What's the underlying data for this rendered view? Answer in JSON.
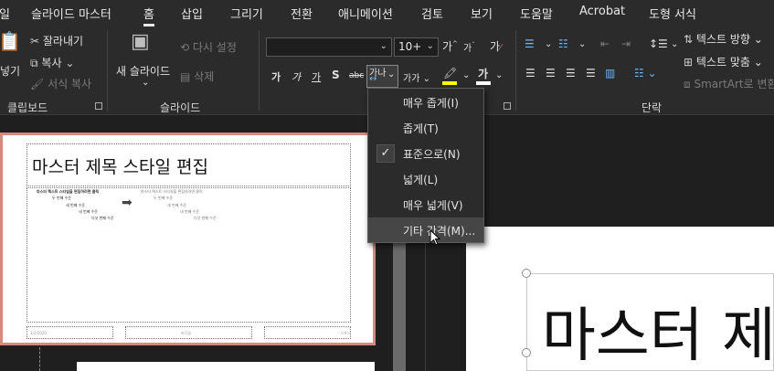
{
  "tabs": [
    {
      "label": "일",
      "x": 0
    },
    {
      "label": "슬라이드 마스터"
    },
    {
      "label": "홈"
    },
    {
      "label": "삽입"
    },
    {
      "label": "그리기"
    },
    {
      "label": "전환"
    },
    {
      "label": "애니메이션"
    },
    {
      "label": "검토"
    },
    {
      "label": "보기"
    },
    {
      "label": "도움말"
    },
    {
      "label": "Acrobat"
    },
    {
      "label": "도형 서식"
    }
  ],
  "clipboard": {
    "paste": "넣기",
    "cut": "잘라내기",
    "copy": "복사",
    "format_painter": "서식 복사",
    "group": "클립보드"
  },
  "slides": {
    "new_slide": "새 슬라이드",
    "reuse": "다시 설정",
    "delete": "삭제",
    "group": "슬라이드"
  },
  "font": {
    "font_name": "",
    "font_size": "10+",
    "grow": "가",
    "shrink": "가",
    "clear": "가",
    "bold": "가",
    "italic": "가",
    "underline": "가",
    "shadow": "S",
    "strike": "abc",
    "spacing": "가나",
    "case": "가가",
    "color_a": "가"
  },
  "paragraph": {
    "text_direction": "텍스트 방향",
    "align_text": "텍스트 맞춤",
    "smartart": "SmartArt로 변환",
    "group": "단락"
  },
  "spacing_menu": {
    "items": [
      {
        "label": "매우 좁게(I)"
      },
      {
        "label": "좁게(T)"
      },
      {
        "label": "표준으로(N)",
        "checked": true
      },
      {
        "label": "넓게(L)"
      },
      {
        "label": "매우 넓게(V)"
      },
      {
        "label": "기타 간격(M)...",
        "hover": true
      }
    ]
  },
  "thumbnail": {
    "title": "마스터 제목 스타일 편집",
    "body_l1": "마스터 텍스트 스타일을 편집하려면 클릭",
    "body_l2": "두 번째 수준",
    "body_l3": "세 번째 수준",
    "body_l4": "네 번째 수준",
    "body_l5": "다섯 번째 수준",
    "footer_date": "1/2/2020",
    "footer_mid": "바닥글",
    "footer_num": "<#>"
  },
  "canvas": {
    "title": "마스터 제"
  },
  "colors": {
    "ribbon_bg": "#2b2b2b",
    "thumb_border": "#d58a80",
    "highlight": "#ffff00",
    "font_color": "#ffffff"
  }
}
